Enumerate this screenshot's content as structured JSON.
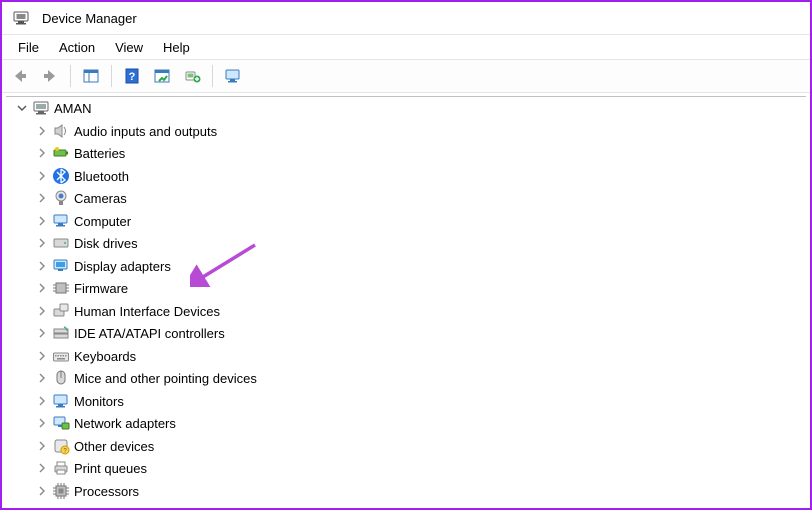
{
  "window": {
    "title": "Device Manager"
  },
  "menu": {
    "file": "File",
    "action": "Action",
    "view": "View",
    "help": "Help"
  },
  "root": {
    "name": "AMAN"
  },
  "categories": [
    {
      "id": "audio",
      "label": "Audio inputs and outputs"
    },
    {
      "id": "batteries",
      "label": "Batteries"
    },
    {
      "id": "bluetooth",
      "label": "Bluetooth"
    },
    {
      "id": "cameras",
      "label": "Cameras"
    },
    {
      "id": "computer",
      "label": "Computer"
    },
    {
      "id": "disk",
      "label": "Disk drives"
    },
    {
      "id": "display",
      "label": "Display adapters"
    },
    {
      "id": "firmware",
      "label": "Firmware"
    },
    {
      "id": "hid",
      "label": "Human Interface Devices"
    },
    {
      "id": "ide",
      "label": "IDE ATA/ATAPI controllers"
    },
    {
      "id": "keyboards",
      "label": "Keyboards"
    },
    {
      "id": "mice",
      "label": "Mice and other pointing devices"
    },
    {
      "id": "monitors",
      "label": "Monitors"
    },
    {
      "id": "network",
      "label": "Network adapters"
    },
    {
      "id": "other",
      "label": "Other devices"
    },
    {
      "id": "printq",
      "label": "Print queues"
    },
    {
      "id": "processors",
      "label": "Processors"
    }
  ],
  "annotation": {
    "arrow_target": "display"
  }
}
